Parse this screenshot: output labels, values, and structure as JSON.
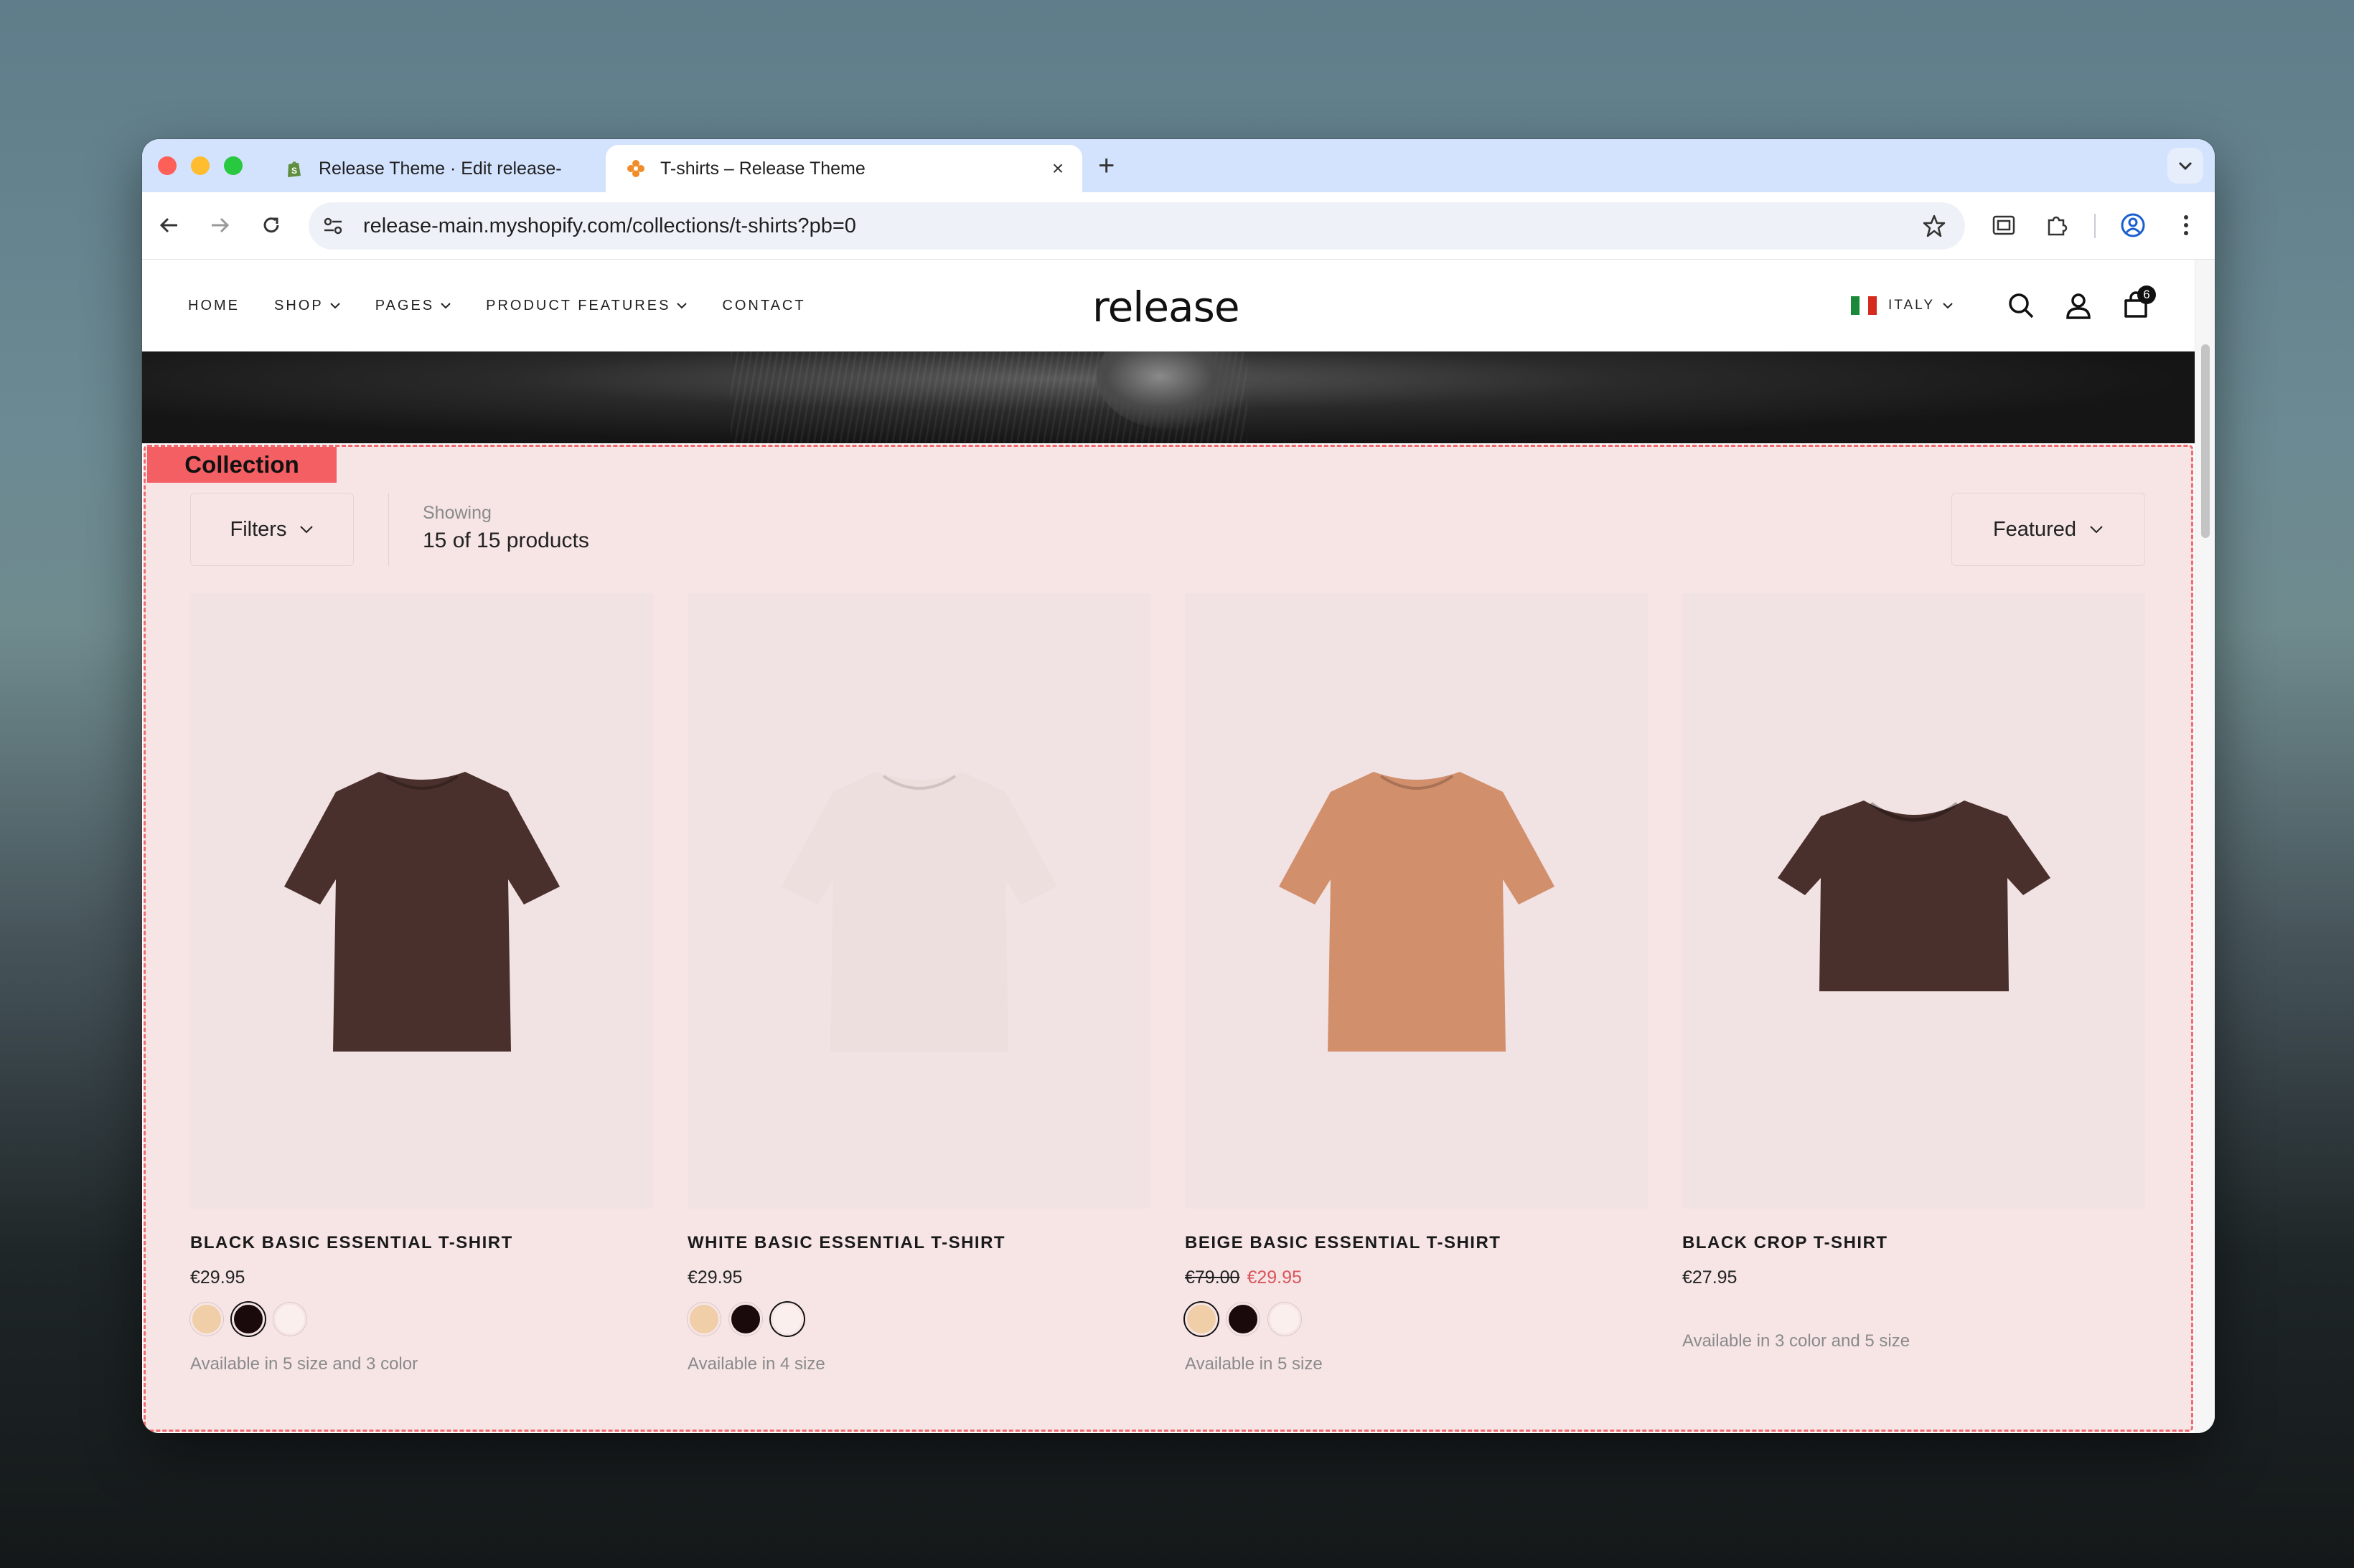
{
  "browser": {
    "tabs": [
      {
        "title": "Release Theme · Edit release-",
        "active": false,
        "favicon": "shopify-icon"
      },
      {
        "title": "T-shirts – Release Theme",
        "active": true,
        "favicon": "release-favicon-icon"
      }
    ],
    "close_glyph": "×",
    "new_tab_glyph": "+",
    "url_host": "release-main.myshopify.com",
    "url_path": "/collections/t-shirts?pb=0"
  },
  "store": {
    "logo": "release",
    "nav": [
      {
        "label": "HOME",
        "has_dropdown": false
      },
      {
        "label": "SHOP",
        "has_dropdown": true
      },
      {
        "label": "PAGES",
        "has_dropdown": true
      },
      {
        "label": "PRODUCT FEATURES",
        "has_dropdown": true
      },
      {
        "label": "CONTACT",
        "has_dropdown": false
      }
    ],
    "country": "ITALY",
    "cart_count": "6"
  },
  "collection": {
    "tag": "Collection",
    "filters_label": "Filters",
    "showing_label": "Showing",
    "showing_count": "15 of 15 products",
    "sort_label": "Featured",
    "products": [
      {
        "name": "BLACK BASIC ESSENTIAL T-SHIRT",
        "price": "€29.95",
        "compare_price": "",
        "swatches": [
          "#f0cfa8",
          "#1a0a0b",
          "#fbefee"
        ],
        "selected_swatch": 1,
        "availability": "Available in 5 size and 3 color",
        "shirt_color": "#4a302c",
        "shirt_style": "regular"
      },
      {
        "name": "WHITE BASIC ESSENTIAL T-SHIRT",
        "price": "€29.95",
        "compare_price": "",
        "swatches": [
          "#f0cfa8",
          "#1a0a0b",
          "#fbefee"
        ],
        "selected_swatch": 2,
        "availability": "Available in 4 size",
        "shirt_color": "#ecdfdd",
        "shirt_style": "regular"
      },
      {
        "name": "BEIGE BASIC ESSENTIAL T-SHIRT",
        "price": "€29.95",
        "compare_price": "€79.00",
        "swatches": [
          "#f0cfa8",
          "#1a0a0b",
          "#fbefee"
        ],
        "selected_swatch": 0,
        "availability": "Available in 5 size",
        "shirt_color": "#d28f6c",
        "shirt_style": "regular"
      },
      {
        "name": "BLACK CROP T-SHIRT",
        "price": "€27.95",
        "compare_price": "",
        "swatches": [],
        "selected_swatch": -1,
        "availability": "Available in 3 color and 5 size",
        "shirt_color": "#4a302c",
        "shirt_style": "crop"
      }
    ]
  }
}
